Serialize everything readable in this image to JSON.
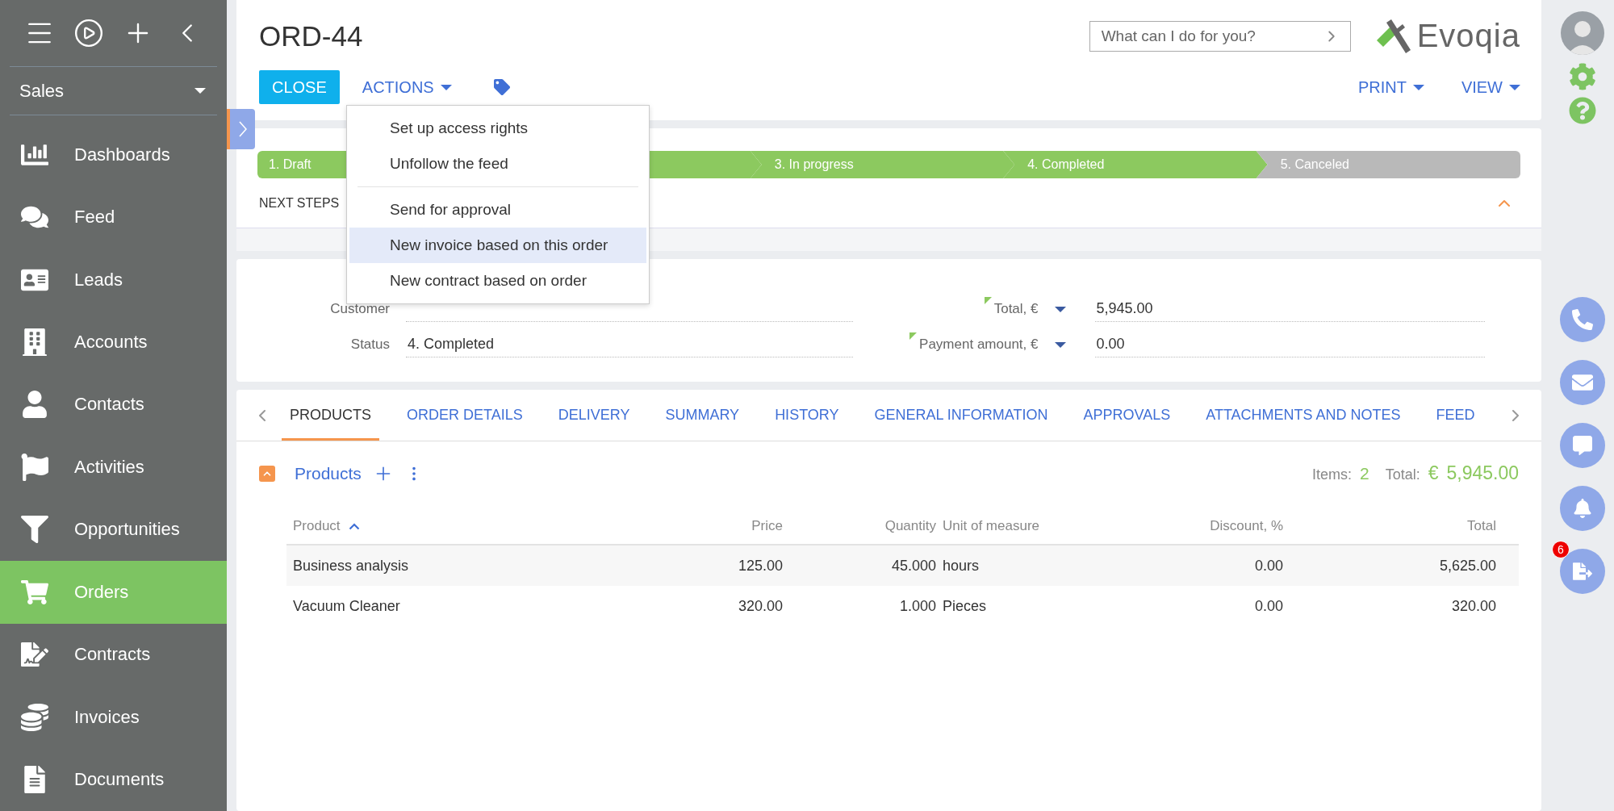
{
  "sidebar": {
    "section": "Sales",
    "items": [
      {
        "label": "Dashboards",
        "selected": false
      },
      {
        "label": "Feed",
        "selected": false
      },
      {
        "label": "Leads",
        "selected": false
      },
      {
        "label": "Accounts",
        "selected": false
      },
      {
        "label": "Contacts",
        "selected": false
      },
      {
        "label": "Activities",
        "selected": false
      },
      {
        "label": "Opportunities",
        "selected": false
      },
      {
        "label": "Orders",
        "selected": true
      },
      {
        "label": "Contracts",
        "selected": false
      },
      {
        "label": "Invoices",
        "selected": false
      },
      {
        "label": "Documents",
        "selected": false
      }
    ]
  },
  "header": {
    "title": "ORD-44",
    "search": {
      "placeholder": "What can I do for you?"
    },
    "logo": "Evoqia",
    "close_button": "CLOSE",
    "actions_button": "ACTIONS",
    "right_buttons": [
      "PRINT",
      "VIEW"
    ]
  },
  "actions_menu": {
    "groups": [
      [
        "Set up access rights",
        "Unfollow the feed"
      ],
      [
        {
          "label": "Send for approval",
          "selected": false
        },
        {
          "label": "New invoice based on this order",
          "selected": true
        },
        {
          "label": "New contract based on order",
          "selected": false
        }
      ]
    ]
  },
  "stages": [
    {
      "label": "1. Draft",
      "done": true
    },
    {
      "done": true
    },
    {
      "label": "3. In progress",
      "done": true
    },
    {
      "label": "4. Completed",
      "done": true
    },
    {
      "label": "5. Canceled",
      "done": false
    }
  ],
  "next_steps": "NEXT STEPS",
  "fields_left": [
    {
      "label": "Customer"
    },
    {
      "label": "Status",
      "value": "4. Completed"
    }
  ],
  "fields_right": [
    {
      "label": "Total, €",
      "value": "5,945.00",
      "required": true
    },
    {
      "label": "Payment amount, €",
      "value": "0.00",
      "required": true
    }
  ],
  "tabs": [
    {
      "label": "PRODUCTS",
      "selected": true
    },
    {
      "label": "ORDER DETAILS",
      "selected": false
    },
    {
      "label": "DELIVERY",
      "selected": false
    },
    {
      "label": "SUMMARY",
      "selected": false
    },
    {
      "label": "HISTORY",
      "selected": false
    },
    {
      "label": "GENERAL INFORMATION",
      "selected": false
    },
    {
      "label": "APPROVALS",
      "selected": false
    },
    {
      "label": "ATTACHMENTS AND NOTES",
      "selected": false
    },
    {
      "label": "FEED",
      "selected": false
    }
  ],
  "products": {
    "title": "Products",
    "items_label": "Items:",
    "items_count": "2",
    "total_label": "Total:",
    "currency": "€",
    "total": "5,945.00",
    "columns": [
      {
        "label": "Product",
        "sorted": true
      },
      {
        "label": "Price",
        "sorted": false
      },
      {
        "label": "Quantity",
        "sorted": false
      },
      {
        "label": "Unit of measure",
        "sorted": false
      },
      {
        "label": "Discount, %",
        "sorted": false
      },
      {
        "label": "Total",
        "sorted": false
      }
    ],
    "rows": [
      [
        "Business analysis",
        "125.00",
        "45.000",
        "hours",
        "0.00",
        "5,625.00"
      ],
      [
        "Vacuum Cleaner",
        "320.00",
        "1.000",
        "Pieces",
        "0.00",
        "320.00"
      ]
    ]
  },
  "notifications": {
    "badge": "6"
  }
}
